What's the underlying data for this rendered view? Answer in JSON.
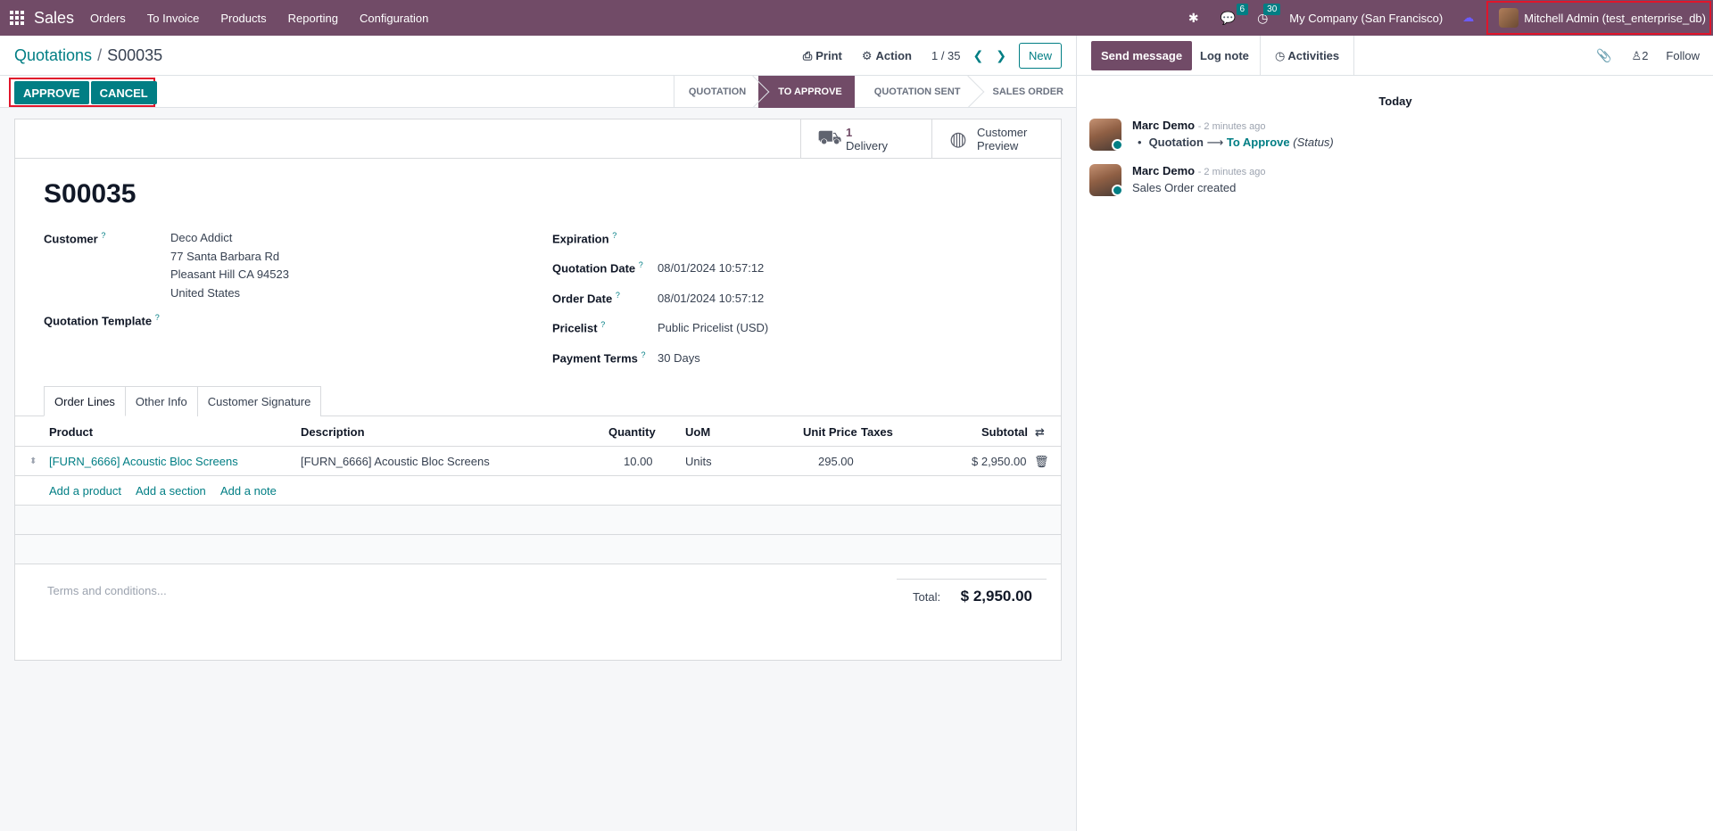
{
  "navbar": {
    "app_name": "Sales",
    "menus": [
      "Orders",
      "To Invoice",
      "Products",
      "Reporting",
      "Configuration"
    ],
    "messages_badge": "6",
    "activities_badge": "30",
    "company": "My Company (San Francisco)",
    "user": "Mitchell Admin (test_enterprise_db)"
  },
  "header": {
    "breadcrumb_parent": "Quotations",
    "breadcrumb_sep": "/",
    "breadcrumb_current": "S00035",
    "print": "Print",
    "action": "Action",
    "pager": "1 / 35",
    "new": "New"
  },
  "status": {
    "approve": "APPROVE",
    "cancel": "CANCEL",
    "stages": [
      "QUOTATION",
      "TO APPROVE",
      "QUOTATION SENT",
      "SALES ORDER"
    ],
    "active_stage": "TO APPROVE"
  },
  "smart_buttons": {
    "delivery_count": "1",
    "delivery_label": "Delivery",
    "preview_line1": "Customer",
    "preview_line2": "Preview"
  },
  "form": {
    "name": "S00035",
    "customer_label": "Customer",
    "customer_name": "Deco Addict",
    "customer_street": "77 Santa Barbara Rd",
    "customer_city": "Pleasant Hill CA 94523",
    "customer_country": "United States",
    "template_label": "Quotation Template",
    "expiration_label": "Expiration",
    "quotation_date_label": "Quotation Date",
    "quotation_date": "08/01/2024 10:57:12",
    "order_date_label": "Order Date",
    "order_date": "08/01/2024 10:57:12",
    "pricelist_label": "Pricelist",
    "pricelist": "Public Pricelist (USD)",
    "payment_terms_label": "Payment Terms",
    "payment_terms": "30 Days",
    "help": "?"
  },
  "tabs": [
    "Order Lines",
    "Other Info",
    "Customer Signature"
  ],
  "lines": {
    "headers": {
      "product": "Product",
      "description": "Description",
      "quantity": "Quantity",
      "uom": "UoM",
      "unit_price": "Unit Price",
      "taxes": "Taxes",
      "subtotal": "Subtotal"
    },
    "rows": [
      {
        "product": "[FURN_6666] Acoustic Bloc Screens",
        "description": "[FURN_6666] Acoustic Bloc Screens",
        "quantity": "10.00",
        "uom": "Units",
        "unit_price": "295.00",
        "taxes": "",
        "subtotal": "$ 2,950.00"
      }
    ],
    "add_product": "Add a product",
    "add_section": "Add a section",
    "add_note": "Add a note"
  },
  "footer": {
    "terms_placeholder": "Terms and conditions...",
    "total_label": "Total:",
    "total_value": "$ 2,950.00"
  },
  "chatter": {
    "send_message": "Send message",
    "log_note": "Log note",
    "activities": "Activities",
    "followers_count": "2",
    "follow": "Follow",
    "day_label": "Today",
    "messages": [
      {
        "author": "Marc Demo",
        "time": "- 2 minutes ago",
        "change_field": "Quotation",
        "change_new": "To Approve",
        "change_suffix": "(Status)"
      },
      {
        "author": "Marc Demo",
        "time": "- 2 minutes ago",
        "body": "Sales Order created"
      }
    ]
  }
}
